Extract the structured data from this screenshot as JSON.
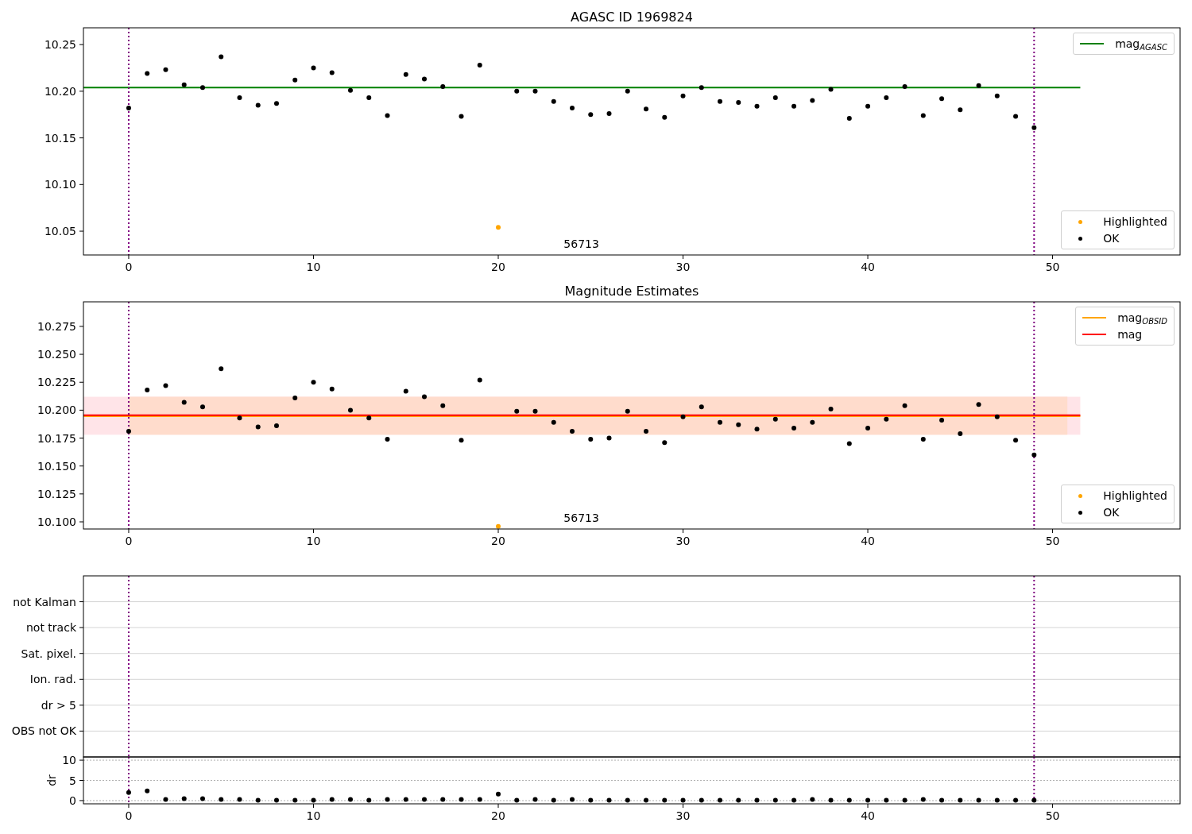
{
  "panels": [
    {
      "title": "AGASC ID 1969824",
      "chart_data": {
        "type": "scatter",
        "x": [
          0,
          1,
          2,
          3,
          4,
          5,
          6,
          7,
          8,
          9,
          10,
          11,
          12,
          13,
          14,
          15,
          16,
          17,
          18,
          19,
          20,
          21,
          22,
          23,
          24,
          25,
          26,
          27,
          28,
          29,
          30,
          31,
          32,
          33,
          34,
          35,
          36,
          37,
          38,
          39,
          40,
          41,
          42,
          43,
          44,
          45,
          46,
          47,
          48,
          49
        ],
        "series": [
          {
            "name": "Highlighted",
            "color": "#ffa500",
            "values": [
              null,
              null,
              null,
              null,
              null,
              null,
              null,
              null,
              null,
              null,
              null,
              null,
              null,
              null,
              null,
              null,
              null,
              null,
              null,
              null,
              10.054,
              null,
              null,
              null,
              null,
              null,
              null,
              null,
              null,
              null,
              null,
              null,
              null,
              null,
              null,
              null,
              null,
              null,
              null,
              null,
              null,
              null,
              null,
              null,
              null,
              null,
              null,
              null,
              null,
              null
            ]
          },
          {
            "name": "OK",
            "color": "#000000",
            "values": [
              10.182,
              10.219,
              10.223,
              10.207,
              10.204,
              10.237,
              10.193,
              10.185,
              10.187,
              10.212,
              10.225,
              10.22,
              10.201,
              10.193,
              10.174,
              10.218,
              10.213,
              10.205,
              10.173,
              10.228,
              null,
              10.2,
              10.2,
              10.189,
              10.182,
              10.175,
              10.176,
              10.2,
              10.181,
              10.172,
              10.195,
              10.204,
              10.189,
              10.188,
              10.184,
              10.193,
              10.184,
              10.19,
              10.202,
              10.171,
              10.184,
              10.193,
              10.205,
              10.174,
              10.192,
              10.18,
              10.206,
              10.195,
              10.173,
              10.161
            ]
          }
        ],
        "xlim": [
          -2.45,
          56.9
        ],
        "ylim": [
          10.0245,
          10.268
        ],
        "xticks": [
          0,
          10,
          20,
          30,
          40,
          50
        ],
        "yticks": [
          {
            "value": 10.05,
            "label": "10.05"
          },
          {
            "value": 10.1,
            "label": "10.10"
          },
          {
            "value": 10.15,
            "label": "10.15"
          },
          {
            "value": 10.2,
            "label": "10.20"
          },
          {
            "value": 10.25,
            "label": "10.25"
          }
        ],
        "ref_lines": [
          {
            "axis": "y",
            "value": 10.204,
            "color": "#008000"
          },
          {
            "axis": "x",
            "value": 0,
            "color": "#800080"
          },
          {
            "axis": "x",
            "value": 49,
            "color": "#800080"
          }
        ],
        "annotations": [
          "56713"
        ]
      },
      "legend": [
        {
          "label": "mag$_{AGASC}$",
          "kind": "line",
          "color": "#008000"
        }
      ]
    },
    {
      "title": "Magnitude Estimates",
      "chart_data": {
        "type": "scatter",
        "x": [
          0,
          1,
          2,
          3,
          4,
          5,
          6,
          7,
          8,
          9,
          10,
          11,
          12,
          13,
          14,
          15,
          16,
          17,
          18,
          19,
          20,
          21,
          22,
          23,
          24,
          25,
          26,
          27,
          28,
          29,
          30,
          31,
          32,
          33,
          34,
          35,
          36,
          37,
          38,
          39,
          40,
          41,
          42,
          43,
          44,
          45,
          46,
          47,
          48,
          49
        ],
        "series": [
          {
            "name": "Highlighted",
            "color": "#ffa500",
            "values": [
              null,
              null,
              null,
              null,
              null,
              null,
              null,
              null,
              null,
              null,
              null,
              null,
              null,
              null,
              null,
              null,
              null,
              null,
              null,
              null,
              10.096,
              null,
              null,
              null,
              null,
              null,
              null,
              null,
              null,
              null,
              null,
              null,
              null,
              null,
              null,
              null,
              null,
              null,
              null,
              null,
              null,
              null,
              null,
              null,
              null,
              null,
              null,
              null,
              null,
              null
            ]
          },
          {
            "name": "OK",
            "color": "#000000",
            "values": [
              10.181,
              10.218,
              10.222,
              10.207,
              10.203,
              10.237,
              10.193,
              10.185,
              10.186,
              10.211,
              10.225,
              10.219,
              10.2,
              10.193,
              10.174,
              10.217,
              10.212,
              10.204,
              10.173,
              10.227,
              null,
              10.199,
              10.199,
              10.189,
              10.181,
              10.174,
              10.175,
              10.199,
              10.181,
              10.171,
              10.194,
              10.203,
              10.189,
              10.187,
              10.183,
              10.192,
              10.184,
              10.189,
              10.201,
              10.17,
              10.184,
              10.192,
              10.204,
              10.174,
              10.191,
              10.179,
              10.205,
              10.194,
              10.173,
              10.16
            ]
          }
        ],
        "xlim": [
          -2.45,
          56.9
        ],
        "ylim": [
          10.0936,
          10.297
        ],
        "xticks": [
          0,
          10,
          20,
          30,
          40,
          50
        ],
        "yticks": [
          {
            "value": 10.1,
            "label": "10.100"
          },
          {
            "value": 10.125,
            "label": "10.125"
          },
          {
            "value": 10.15,
            "label": "10.150"
          },
          {
            "value": 10.175,
            "label": "10.175"
          },
          {
            "value": 10.2,
            "label": "10.200"
          },
          {
            "value": 10.225,
            "label": "10.225"
          },
          {
            "value": 10.25,
            "label": "10.250"
          },
          {
            "value": 10.275,
            "label": "10.275"
          }
        ],
        "bands": [
          {
            "axis": "y",
            "from": 10.178,
            "to": 10.212,
            "color": "#ffe4e8"
          },
          {
            "axis": "y",
            "from": 10.178,
            "to": 10.212,
            "color": "#ffdccc"
          }
        ],
        "ref_lines": [
          {
            "axis": "y",
            "value": 10.1945,
            "color": "#ffa500"
          },
          {
            "axis": "y",
            "value": 10.1955,
            "color": "#ff0000"
          },
          {
            "axis": "x",
            "value": 0,
            "color": "#800080"
          },
          {
            "axis": "x",
            "value": 49,
            "color": "#800080"
          }
        ],
        "annotations": [
          "56713"
        ]
      },
      "legend": [
        {
          "label": "mag$_{OBSID}$",
          "kind": "line",
          "color": "#ffa500"
        },
        {
          "label": "mag",
          "kind": "line",
          "color": "#ff0000"
        }
      ]
    }
  ],
  "flags": {
    "labels": [
      "not Kalman",
      "not track",
      "Sat. pixel.",
      "Ion. rad.",
      "dr > 5",
      "OBS not OK"
    ],
    "grid": true
  },
  "dr_chart": {
    "chart_data": {
      "type": "scatter",
      "ylabel": "dr",
      "grid": true,
      "x": [
        0,
        1,
        2,
        3,
        4,
        5,
        6,
        7,
        8,
        9,
        10,
        11,
        12,
        13,
        14,
        15,
        16,
        17,
        18,
        19,
        20,
        21,
        22,
        23,
        24,
        25,
        26,
        27,
        28,
        29,
        30,
        31,
        32,
        33,
        34,
        35,
        36,
        37,
        38,
        39,
        40,
        41,
        42,
        43,
        44,
        45,
        46,
        47,
        48,
        49
      ],
      "series": [
        {
          "color": "#000000",
          "values": [
            2.0,
            2.4,
            0.3,
            0.5,
            0.5,
            0.3,
            0.3,
            0.1,
            0.1,
            0.1,
            0.1,
            0.3,
            0.3,
            0.1,
            0.3,
            0.3,
            0.3,
            0.3,
            0.3,
            0.3,
            1.6,
            0.1,
            0.3,
            0.1,
            0.3,
            0.1,
            0.1,
            0.1,
            0.1,
            0.1,
            0.1,
            0.1,
            0.1,
            0.1,
            0.1,
            0.1,
            0.1,
            0.3,
            0.1,
            0.1,
            0.1,
            0.1,
            0.1,
            0.3,
            0.1,
            0.1,
            0.1,
            0.1,
            0.1,
            0.1
          ]
        }
      ],
      "xlim": [
        -2.45,
        56.9
      ],
      "ylim": [
        -0.8,
        10.8
      ],
      "xticks": [
        0,
        10,
        20,
        30,
        40,
        50
      ],
      "yticks": [
        0,
        5,
        10
      ],
      "ref_lines": [
        {
          "axis": "x",
          "value": 0,
          "color": "#800080"
        },
        {
          "axis": "x",
          "value": 49,
          "color": "#800080"
        }
      ]
    }
  }
}
